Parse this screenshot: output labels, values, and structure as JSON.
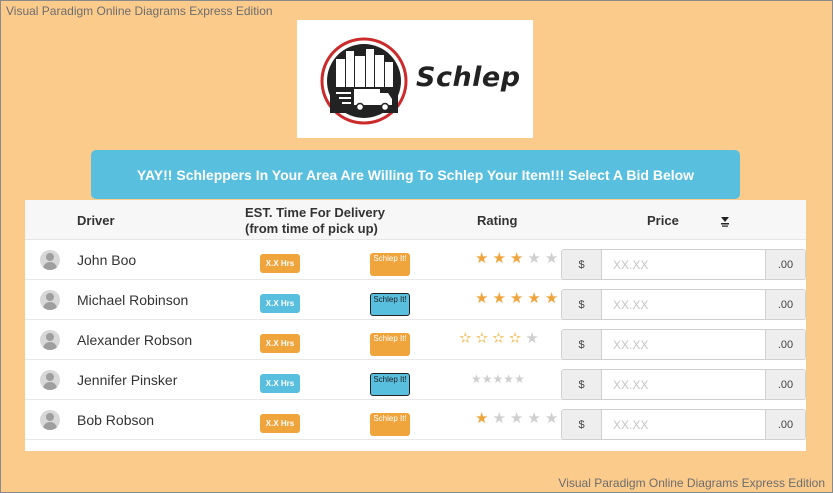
{
  "watermark": {
    "top": "Visual Paradigm Online Diagrams Express Edition",
    "bottom": "Visual Paradigm Online Diagrams Express Edition"
  },
  "logo": {
    "text": "Schlep"
  },
  "banner": {
    "text": "YAY!! Schleppers In Your Area Are Willing To Schlep Your Item!!! Select A Bid Below"
  },
  "table": {
    "headers": {
      "driver": "Driver",
      "time_line1": "EST. Time For Delivery",
      "time_line2": "(from time of pick up)",
      "rating": "Rating",
      "price": "Price"
    },
    "rows": [
      {
        "driver": "John Boo",
        "time": "X.X Hrs",
        "time_color": "orange",
        "schlep": "Schlep It!",
        "schlep_color": "orange",
        "rating": 3,
        "rating_style": "filled",
        "currency": "$",
        "price_placeholder": "XX.XX",
        "decimal": ".00"
      },
      {
        "driver": "Michael Robinson",
        "time": "X.X Hrs",
        "time_color": "blue",
        "schlep": "Schlep It!",
        "schlep_color": "blue",
        "rating": 5,
        "rating_style": "filled",
        "currency": "$",
        "price_placeholder": "XX.XX",
        "decimal": ".00"
      },
      {
        "driver": "Alexander Robson",
        "time": "X.X Hrs",
        "time_color": "orange",
        "schlep": "Schlep It!",
        "schlep_color": "orange",
        "rating": 4,
        "rating_style": "outline",
        "currency": "$",
        "price_placeholder": "XX.XX",
        "decimal": ".00"
      },
      {
        "driver": "Jennifer Pinsker",
        "time": "X.X Hrs",
        "time_color": "blue",
        "schlep": "Schlep It!",
        "schlep_color": "blue",
        "rating": 0,
        "rating_style": "small",
        "currency": "$",
        "price_placeholder": "XX.XX",
        "decimal": ".00"
      },
      {
        "driver": "Bob Robson",
        "time": "X.X Hrs",
        "time_color": "orange",
        "schlep": "Schlep It!",
        "schlep_color": "orange",
        "rating": 1,
        "rating_style": "filled",
        "currency": "$",
        "price_placeholder": "XX.XX",
        "decimal": ".00"
      }
    ]
  },
  "colors": {
    "background": "#fbcb8c",
    "accent_blue": "#58bfdf",
    "accent_orange": "#f0a43c",
    "star": "#f0a43c"
  },
  "icons": {
    "sort": "sort-descending-icon",
    "avatar": "user-avatar-icon",
    "logo": "truck-city-icon"
  }
}
